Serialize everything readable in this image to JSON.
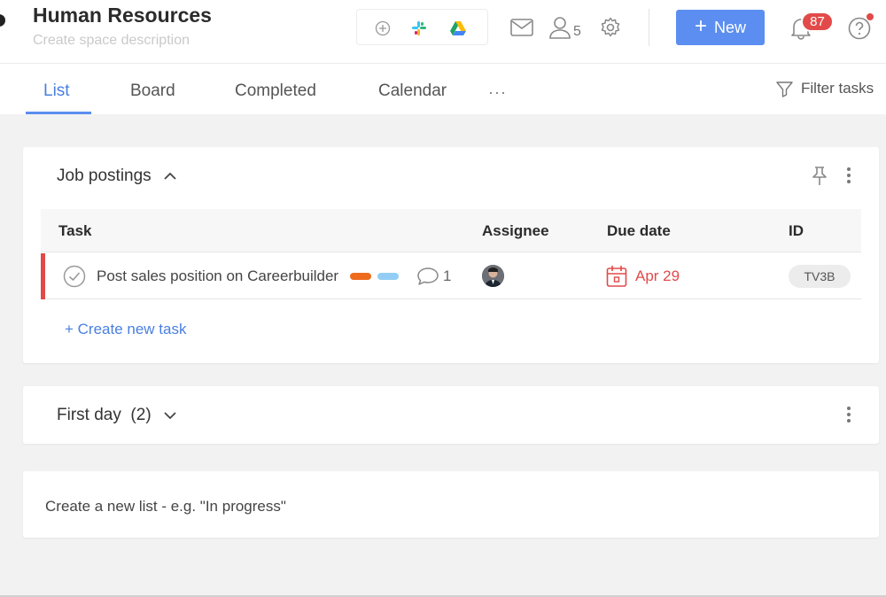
{
  "header": {
    "title": "Human Resources",
    "description": "Create space description",
    "integrations": [
      "add-integration-icon",
      "slack-icon",
      "google-drive-icon"
    ],
    "members_count": "5",
    "new_button": "New",
    "notifications_count": "87"
  },
  "tabs": [
    {
      "label": "List",
      "active": true
    },
    {
      "label": "Board"
    },
    {
      "label": "Completed"
    },
    {
      "label": "Calendar"
    }
  ],
  "more_label": "···",
  "filter_label": "Filter tasks",
  "lists": [
    {
      "title": "Job postings",
      "columns": {
        "task": "Task",
        "assignee": "Assignee",
        "due": "Due date",
        "id": "ID"
      },
      "tasks": [
        {
          "name": "Post sales position on Careerbuilder",
          "tags": [
            "#ee6a1c",
            "#93cdf5"
          ],
          "comments": "1",
          "due": "Apr 29",
          "id": "TV3B"
        }
      ],
      "create_task": "+ Create new task"
    },
    {
      "title": "First day",
      "count": "(2)"
    }
  ],
  "new_list_prompt": "Create a new list - e.g. \"In progress\"",
  "colors": {
    "accent": "#5b8ef0",
    "danger": "#e24a4a"
  }
}
